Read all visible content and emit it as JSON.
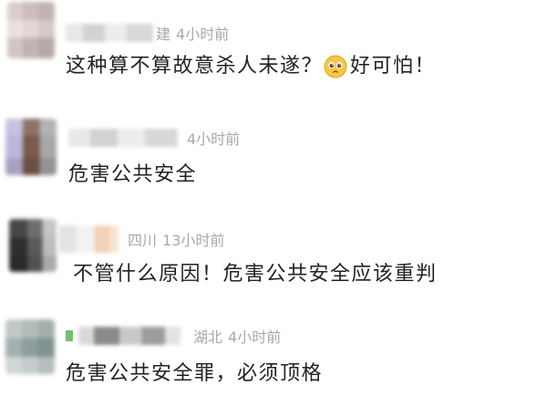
{
  "comments": [
    {
      "username_visible": "建",
      "time": "4小时前",
      "text_before": "这种算不算故意杀人未遂？",
      "emoji": "pleading-face-icon",
      "text_after": "好可怕！"
    },
    {
      "time": "4小时前",
      "text": "危害公共安全"
    },
    {
      "location": "四川",
      "time": "13小时前",
      "text": "不管什么原因！危害公共安全应该重判"
    },
    {
      "badge_icon": "green-badge-icon",
      "location": "湖北",
      "time": "4小时前",
      "text": "危害公共安全罪，必须顶格"
    }
  ]
}
